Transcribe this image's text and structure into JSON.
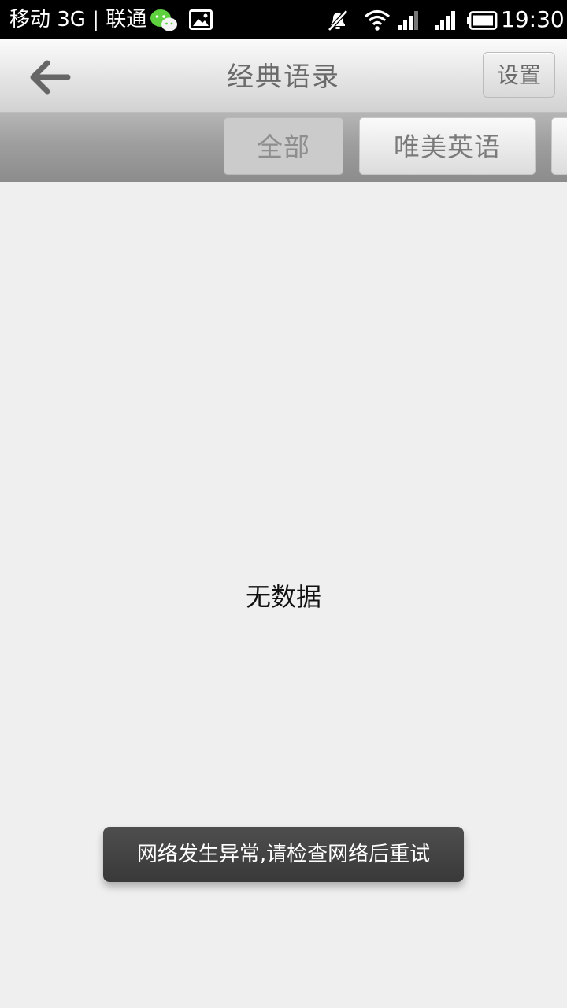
{
  "status_bar": {
    "carrier_text": "移动 3G | 联通",
    "time": "19:30",
    "icons": [
      "wechat-icon",
      "image-notification-icon",
      "mute-icon",
      "wifi-icon",
      "signal-icon",
      "signal-icon",
      "battery-icon"
    ]
  },
  "header": {
    "title": "经典语录",
    "back_icon": "back-arrow-icon",
    "settings_label": "设置"
  },
  "tabs": [
    {
      "label": "全部",
      "active": true
    },
    {
      "label": "唯美英语",
      "active": false
    }
  ],
  "content": {
    "empty_text": "无数据"
  },
  "toast": {
    "message": "网络发生异常,请检查网络后重试"
  },
  "colors": {
    "status_bar": "#000000",
    "page_background": "#efefef",
    "toast_background": "#3f3f3f"
  }
}
